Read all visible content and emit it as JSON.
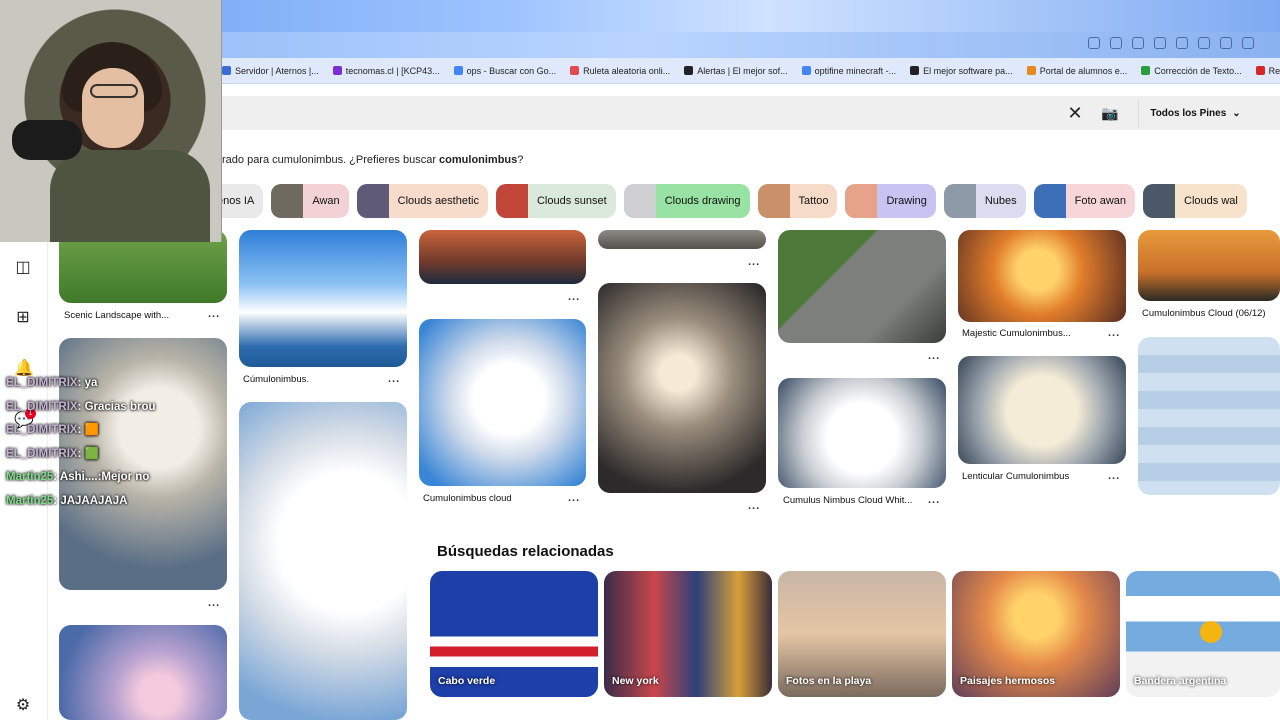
{
  "bookmarks": [
    {
      "label": "Servidor | Aternos |...",
      "color": "#3b6bd6"
    },
    {
      "label": "tecnomas.cl | [KCP43...",
      "color": "#7b2fd4"
    },
    {
      "label": "ops - Buscar con Go...",
      "color": "#4285f4"
    },
    {
      "label": "Ruleta aleatoria onli...",
      "color": "#e5484d"
    },
    {
      "label": "Alertas | El mejor sof...",
      "color": "#222222"
    },
    {
      "label": "optifine minecraft -...",
      "color": "#4285f4"
    },
    {
      "label": "El mejor software pa...",
      "color": "#222222"
    },
    {
      "label": "Portal de alumnos e...",
      "color": "#e58a1f"
    },
    {
      "label": "Corrección de Texto...",
      "color": "#2a9d3a"
    },
    {
      "label": "Regístrate como do...",
      "color": "#d62828"
    }
  ],
  "search": {
    "clear_icon": "close-icon",
    "camera_icon": "camera-icon",
    "scope_label": "Todos los Pines"
  },
  "suggestion": {
    "prefix": "rado para cumulonimbus. ¿Prefieres buscar ",
    "term": "comulonimbus",
    "suffix": "?"
  },
  "chips": [
    {
      "label": "enos IA",
      "bg": "#e9e9e9",
      "thumb": ""
    },
    {
      "label": "Awan",
      "bg": "#f3d2d6",
      "thumb": "#6f6a60"
    },
    {
      "label": "Clouds aesthetic",
      "bg": "#f7dccc",
      "thumb": "#5e5a78"
    },
    {
      "label": "Clouds sunset",
      "bg": "#dbe9dc",
      "thumb": "#c0463a"
    },
    {
      "label": "Clouds drawing",
      "bg": "#98e3a3",
      "thumb": "#cfcfd2"
    },
    {
      "label": "Tattoo",
      "bg": "#f6dcc8",
      "thumb": "#c9906a"
    },
    {
      "label": "Drawing",
      "bg": "#c9c3f2",
      "thumb": "#e7a38a"
    },
    {
      "label": "Nubes",
      "bg": "#dcdcf0",
      "thumb": "#8f9aa8"
    },
    {
      "label": "Foto awan",
      "bg": "#f7d6da",
      "thumb": "#3d6fb8"
    },
    {
      "label": "Clouds wal",
      "bg": "#f7e2cb",
      "thumb": "#4a5868"
    }
  ],
  "pins": {
    "captions": [
      "Scenic Landscape with...",
      "Cúmulonimbus.",
      "Cumulonimbus cloud",
      "Majestic Cumulonimbus...",
      "Cumulonimbus Cloud (06/12)",
      "Cumulus Nimbus Cloud Whit...",
      "Lenticular Cumulonimbus"
    ],
    "more": "..."
  },
  "related": {
    "title": "Búsquedas relacionadas",
    "items": [
      "Cabo verde",
      "New york",
      "Fotos en la playa",
      "Paisajes hermosos",
      "Bandera argentina"
    ]
  },
  "chat": [
    {
      "name": "EL_DIMITRIX",
      "msg": ": ya"
    },
    {
      "name": "EL_DIMITRIX",
      "msg": ": Gracias brou"
    },
    {
      "name": "EL_DIMITRIX",
      "msg": ": 🟧"
    },
    {
      "name": "EL_DIMITRIX",
      "msg": ": 🟩"
    },
    {
      "name": "Martin25",
      "msg": ": Ashi....:Mejor no"
    },
    {
      "name": "Martin25",
      "msg": ": JAJAAJAJA"
    }
  ],
  "notifications": {
    "count": "1"
  }
}
